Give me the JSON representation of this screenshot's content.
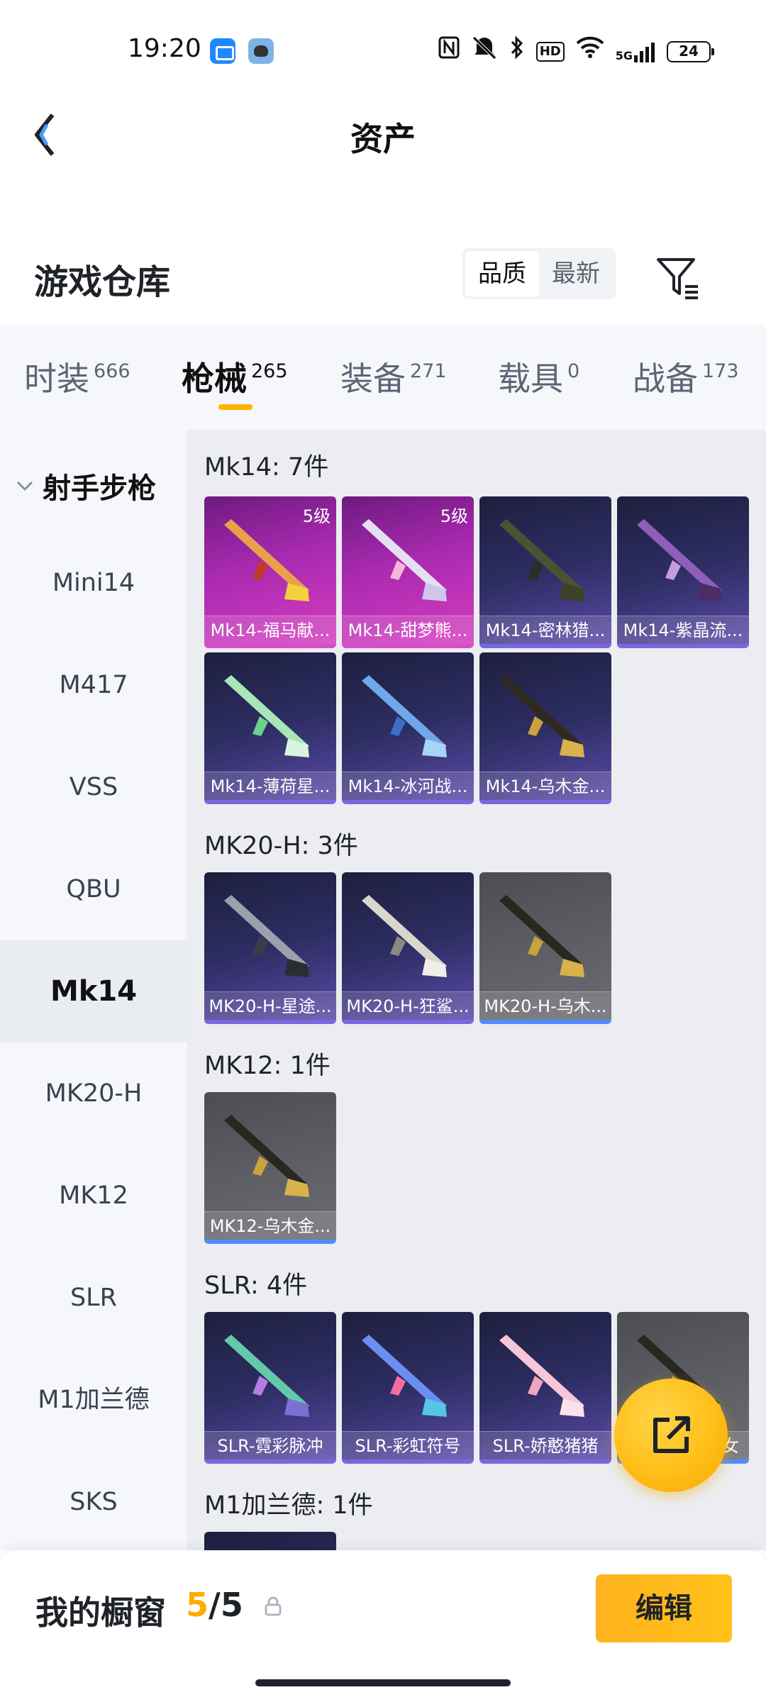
{
  "status_bar": {
    "time": "19:20",
    "icons": [
      "nfc-icon",
      "mute-icon",
      "bluetooth-icon",
      "hd-icon",
      "wifi-icon",
      "signal-5g-icon",
      "battery-icon"
    ],
    "hd": "HD",
    "signal": "5G",
    "battery": "24"
  },
  "nav": {
    "title": "资产"
  },
  "header": {
    "section_title": "游戏仓库",
    "sort": {
      "quality": "品质",
      "newest": "最新",
      "selected": "品质"
    }
  },
  "tabs": [
    {
      "label": "时装",
      "count": "666"
    },
    {
      "label": "枪械",
      "count": "265",
      "active": true
    },
    {
      "label": "装备",
      "count": "271"
    },
    {
      "label": "载具",
      "count": "0"
    },
    {
      "label": "战备",
      "count": "173"
    }
  ],
  "sidebar": {
    "category": "射手步枪",
    "items": [
      "Mini14",
      "M417",
      "VSS",
      "QBU",
      "Mk14",
      "MK20-H",
      "MK12",
      "SLR",
      "M1加兰德",
      "SKS"
    ],
    "active": "Mk14"
  },
  "groups": [
    {
      "title": "Mk14: 7件",
      "items": [
        {
          "name": "Mk14-福马献...",
          "level": "5级",
          "rarity": "pink"
        },
        {
          "name": "Mk14-甜梦熊...",
          "level": "5级",
          "rarity": "pink"
        },
        {
          "name": "Mk14-密林猎...",
          "rarity": "purple"
        },
        {
          "name": "Mk14-紫晶流...",
          "rarity": "purple"
        },
        {
          "name": "Mk14-薄荷星...",
          "rarity": "purple"
        },
        {
          "name": "Mk14-冰河战...",
          "rarity": "purple"
        },
        {
          "name": "Mk14-乌木金...",
          "rarity": "purple"
        }
      ]
    },
    {
      "title": "MK20-H: 3件",
      "items": [
        {
          "name": "MK20-H-星途...",
          "rarity": "purple"
        },
        {
          "name": "MK20-H-狂鲨...",
          "rarity": "purple"
        },
        {
          "name": "MK20-H-乌木...",
          "rarity": "gray"
        }
      ]
    },
    {
      "title": "MK12: 1件",
      "items": [
        {
          "name": "MK12-乌木金...",
          "rarity": "gray"
        }
      ]
    },
    {
      "title": "SLR: 4件",
      "items": [
        {
          "name": "SLR-霓彩脉冲",
          "rarity": "purple"
        },
        {
          "name": "SLR-彩虹符号",
          "rarity": "purple"
        },
        {
          "name": "SLR-娇憨猪猪",
          "rarity": "purple"
        },
        {
          "name": "...女",
          "rarity": "gray"
        }
      ]
    },
    {
      "title": "M1加兰德: 1件",
      "items": []
    }
  ],
  "fab": {
    "icon": "share-external-icon"
  },
  "bottom": {
    "title": "我的橱窗",
    "current": "5",
    "separator": "/",
    "max": "5",
    "edit_label": "编辑"
  },
  "colors": {
    "accent": "#ffb300",
    "pink_rarity": "#d53dbf",
    "purple_rarity": "#5b4aa8",
    "gray_rarity": "#5f6167"
  }
}
